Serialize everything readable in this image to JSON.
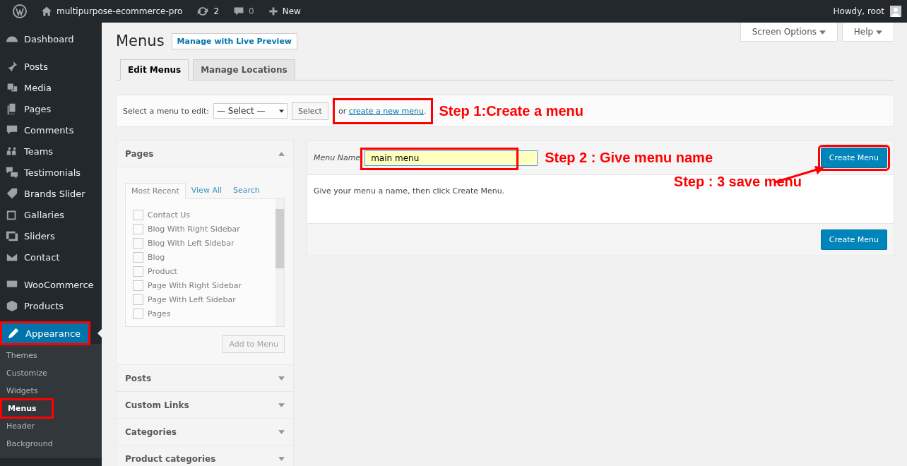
{
  "admin_bar": {
    "site_name": "multipurpose-ecommerce-pro",
    "updates": "2",
    "comments": "0",
    "new": "New",
    "greeting": "Howdy, root"
  },
  "sidebar": {
    "sections": [
      [
        {
          "label": "Dashboard",
          "selected": false,
          "annotated": false
        }
      ],
      [
        {
          "label": "Posts",
          "selected": false,
          "annotated": false
        },
        {
          "label": "Media",
          "selected": false,
          "annotated": false
        },
        {
          "label": "Pages",
          "selected": false,
          "annotated": false
        },
        {
          "label": "Comments",
          "selected": false,
          "annotated": false
        },
        {
          "label": "Teams",
          "selected": false,
          "annotated": false
        },
        {
          "label": "Testimonials",
          "selected": false,
          "annotated": false
        },
        {
          "label": "Brands Slider",
          "selected": false,
          "annotated": false
        },
        {
          "label": "Gallaries",
          "selected": false,
          "annotated": false
        },
        {
          "label": "Sliders",
          "selected": false,
          "annotated": false
        },
        {
          "label": "Contact",
          "selected": false,
          "annotated": false
        }
      ],
      [
        {
          "label": "WooCommerce",
          "selected": false,
          "annotated": false
        },
        {
          "label": "Products",
          "selected": false,
          "annotated": false
        }
      ],
      [
        {
          "label": "Appearance",
          "selected": true,
          "annotated": true,
          "children": [
            {
              "label": "Themes",
              "selected": false,
              "annotated": false
            },
            {
              "label": "Customize",
              "selected": false,
              "annotated": false
            },
            {
              "label": "Widgets",
              "selected": false,
              "annotated": false
            },
            {
              "label": "Menus",
              "selected": true,
              "annotated": true
            },
            {
              "label": "Header",
              "selected": false,
              "annotated": false
            },
            {
              "label": "Background",
              "selected": false,
              "annotated": false
            }
          ]
        }
      ]
    ]
  },
  "screen_meta": [
    "Screen Options",
    "Help"
  ],
  "page_title": "Menus",
  "title_action": "Manage with Live Preview",
  "tabs": [
    {
      "label": "Edit Menus",
      "selected": true
    },
    {
      "label": "Manage Locations",
      "selected": false
    }
  ],
  "select_bar": {
    "label": "Select a menu to edit:",
    "select": "— Select —",
    "button": "Select",
    "before_link": "or",
    "link": "create a new menu",
    "after_link": ".",
    "annotated": true,
    "step": "Step 1:Create a menu"
  },
  "menu_items": {
    "disabled": true,
    "panels": [
      {
        "title": "Pages",
        "expanded": true,
        "tabs": [
          {
            "label": "Most Recent",
            "selected": true
          },
          {
            "label": "View All",
            "selected": false
          },
          {
            "label": "Search",
            "selected": false
          }
        ],
        "items": [
          {
            "label": "Contact Us",
            "checked": false
          },
          {
            "label": "Blog With Right Sidebar",
            "checked": false
          },
          {
            "label": "Blog With Left Sidebar",
            "checked": false
          },
          {
            "label": "Blog",
            "checked": false
          },
          {
            "label": "Product",
            "checked": false
          },
          {
            "label": "Page With Right Sidebar",
            "checked": false
          },
          {
            "label": "Page With Left Sidebar",
            "checked": false
          },
          {
            "label": "Pages",
            "checked": false
          }
        ],
        "button": "Add to Menu"
      },
      {
        "title": "Posts",
        "expanded": false
      },
      {
        "title": "Custom Links",
        "expanded": false
      },
      {
        "title": "Categories",
        "expanded": false
      },
      {
        "title": "Product categories",
        "expanded": false
      }
    ]
  },
  "menu_editor": {
    "name_label": "Menu Name",
    "name_value": "main menu",
    "name_annotated": true,
    "step_name": "Step 2 : Give menu name",
    "create_button": "Create Menu",
    "create_annotated": true,
    "step_save": "Step : 3 save menu",
    "description": "Give your menu a name, then click Create Menu.",
    "footer_button": "Create Menu"
  }
}
